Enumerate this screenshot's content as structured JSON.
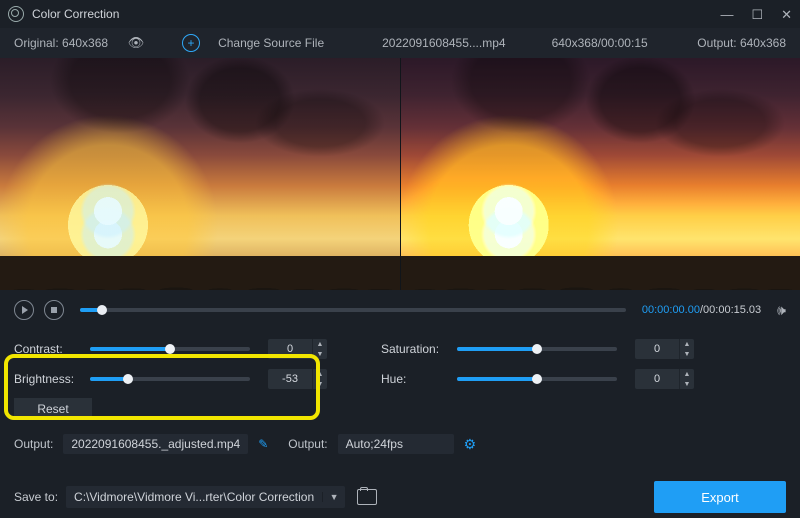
{
  "window": {
    "title": "Color Correction"
  },
  "subbar": {
    "original_label": "Original: 640x368",
    "change_source": "Change Source File",
    "filename": "2022091608455....mp4",
    "dims_duration": "640x368/00:00:15",
    "output_label": "Output: 640x368"
  },
  "playback": {
    "current": "00:00:00.00",
    "total": "00:00:15.03"
  },
  "sliders": {
    "contrast": {
      "label": "Contrast:",
      "value": "0",
      "fill_pct": 50,
      "knob_pct": 50
    },
    "brightness": {
      "label": "Brightness:",
      "value": "-53",
      "fill_pct": 24,
      "knob_pct": 24
    },
    "saturation": {
      "label": "Saturation:",
      "value": "0",
      "fill_pct": 50,
      "knob_pct": 50
    },
    "hue": {
      "label": "Hue:",
      "value": "0",
      "fill_pct": 50,
      "knob_pct": 50
    },
    "reset_label": "Reset"
  },
  "output": {
    "label1": "Output:",
    "filename": "2022091608455._adjusted.mp4",
    "label2": "Output:",
    "format": "Auto;24fps"
  },
  "save": {
    "label": "Save to:",
    "path": "C:\\Vidmore\\Vidmore Vi...rter\\Color Correction"
  },
  "export_label": "Export"
}
